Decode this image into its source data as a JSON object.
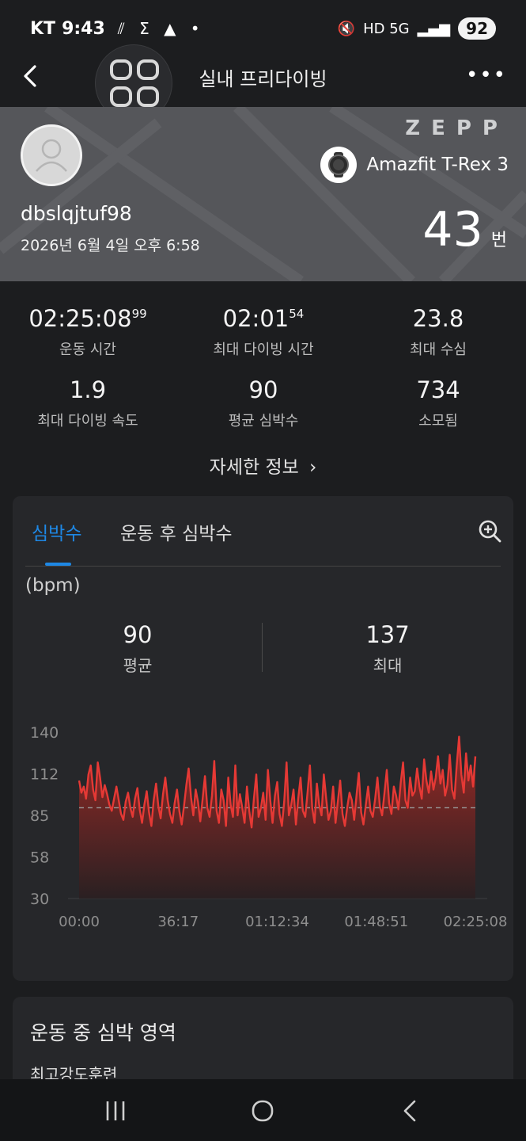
{
  "status_bar": {
    "carrier": "KT",
    "time": "9:43",
    "signal_text": "HD 5G",
    "battery": "92"
  },
  "header": {
    "title": "실내 프리다이빙",
    "more_label": "•••"
  },
  "profile": {
    "username": "dbslqjtuf98",
    "datetime": "2026년 6월 4일 오후 6:58",
    "brand_logo": "ZEPP",
    "device_name": "Amazfit T-Rex 3",
    "count": "43",
    "count_unit": "번"
  },
  "stats": [
    {
      "value": "02:25:08",
      "sup": "99",
      "label": "운동 시간"
    },
    {
      "value": "02:01",
      "sup": "54",
      "label": "최대 다이빙 시간"
    },
    {
      "value": "23.8",
      "sup": "",
      "label": "최대 수심"
    },
    {
      "value": "1.9",
      "sup": "",
      "label": "최대 다이빙 속도"
    },
    {
      "value": "90",
      "sup": "",
      "label": "평균 심박수"
    },
    {
      "value": "734",
      "sup": "",
      "label": "소모됨"
    }
  ],
  "details_link": "자세한 정보",
  "hr_card": {
    "tabs": [
      "심박수",
      "운동 후 심박수"
    ],
    "active_tab": 0,
    "unit": "(bpm)",
    "average": {
      "value": "90",
      "label": "평균"
    },
    "max": {
      "value": "137",
      "label": "최대"
    }
  },
  "chart_data": {
    "type": "area",
    "title": "",
    "xlabel": "",
    "ylabel": "(bpm)",
    "y_ticks": [
      "140",
      "112",
      "85",
      "58",
      "30"
    ],
    "x_ticks": [
      "00:00",
      "36:17",
      "01:12:34",
      "01:48:51",
      "02:25:08"
    ],
    "ylim": [
      30,
      140
    ],
    "x_range_seconds": [
      0,
      8708
    ],
    "average_line": 90,
    "colors": {
      "line": "#e53935",
      "fill_top": "#9b2a26",
      "fill_bottom": "#2a2022",
      "avg_line": "#9a9a9a"
    },
    "series": [
      {
        "values": [
          108,
          100,
          104,
          96,
          112,
          118,
          102,
          95,
          120,
          110,
          97,
          105,
          99,
          92,
          88,
          96,
          104,
          95,
          86,
          82,
          94,
          100,
          90,
          84,
          96,
          103,
          89,
          80,
          92,
          101,
          87,
          78,
          95,
          106,
          91,
          83,
          99,
          110,
          95,
          86,
          80,
          93,
          102,
          88,
          79,
          91,
          105,
          116,
          97,
          85,
          102,
          94,
          81,
          96,
          111,
          90,
          84,
          98,
          121,
          88,
          80,
          102,
          95,
          78,
          110,
          92,
          84,
          118,
          85,
          99,
          90,
          80,
          104,
          88,
          77,
          96,
          112,
          84,
          90,
          100,
          82,
          115,
          95,
          80,
          98,
          107,
          86,
          78,
          94,
          120,
          85,
          92,
          102,
          79,
          96,
          110,
          88,
          84,
          100,
          118,
          90,
          80,
          106,
          92,
          85,
          112,
          96,
          82,
          88,
          104,
          80,
          94,
          108,
          86,
          78,
          90,
          100,
          95,
          82,
          98,
          113,
          87,
          79,
          92,
          104,
          88,
          84,
          96,
          110,
          91,
          85,
          100,
          115,
          93,
          86,
          104,
          98,
          89,
          107,
          120,
          95,
          90,
          110,
          98,
          101,
          116,
          104,
          96,
          122,
          108,
          100,
          114,
          102,
          110,
          124,
          106,
          115,
          98,
          105,
          125,
          102,
          96,
          118,
          137,
          112,
          100,
          126,
          108,
          118,
          104,
          124
        ]
      }
    ]
  },
  "zone_card": {
    "title": "운동 중 심박 영역",
    "first_zone": "최고강도훈련"
  },
  "icons": {
    "back": "chevron-left-icon",
    "more": "more-dots-icon",
    "zoom": "zoom-in-icon",
    "device": "watch-icon",
    "avatar": "user-icon"
  }
}
